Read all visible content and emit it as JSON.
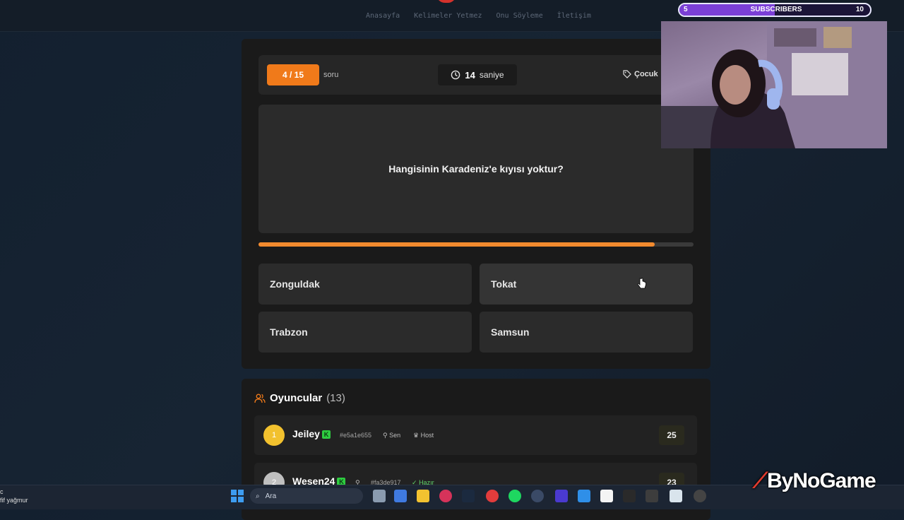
{
  "nav": {
    "links": [
      "Anasayfa",
      "Kelimeler Yetmez",
      "Onu Söyleme",
      "İletişim"
    ]
  },
  "quiz": {
    "counter": "4 / 15",
    "counter_label": "soru",
    "timer_value": "14",
    "timer_label": "saniye",
    "category": "Çocuk",
    "question": "Hangisinin Karadeniz'e kıyısı yoktur?",
    "progress": 0.91,
    "answers": [
      "Zonguldak",
      "Tokat",
      "Trabzon",
      "Samsun"
    ]
  },
  "players": {
    "title": "Oyuncular",
    "count": "(13)",
    "rows": [
      {
        "rank": "1",
        "name": "Jeiley",
        "id": "#e5a1e655",
        "tag1": "Sen",
        "tag2": "Host",
        "score": "25",
        "rank_color": "#f2c12e"
      },
      {
        "rank": "2",
        "name": "Wesen24",
        "id": "#fa3de917",
        "tag1": "",
        "tag2": "Hazır",
        "score": "23",
        "rank_color": "#bfbfbf"
      }
    ]
  },
  "overlay": {
    "sub_left": "5",
    "sub_label": "SUBSCRIBERS",
    "sub_right": "10",
    "sub_progress": 0.5,
    "brand": "ByNoGame"
  },
  "taskbar": {
    "weather_line1": "c",
    "weather_line2": "fif yağmur",
    "search_placeholder": "Ara"
  },
  "colors": {
    "accent": "#f07a1a",
    "progress": "#f28a2e",
    "panel": "#1a1a1a"
  }
}
